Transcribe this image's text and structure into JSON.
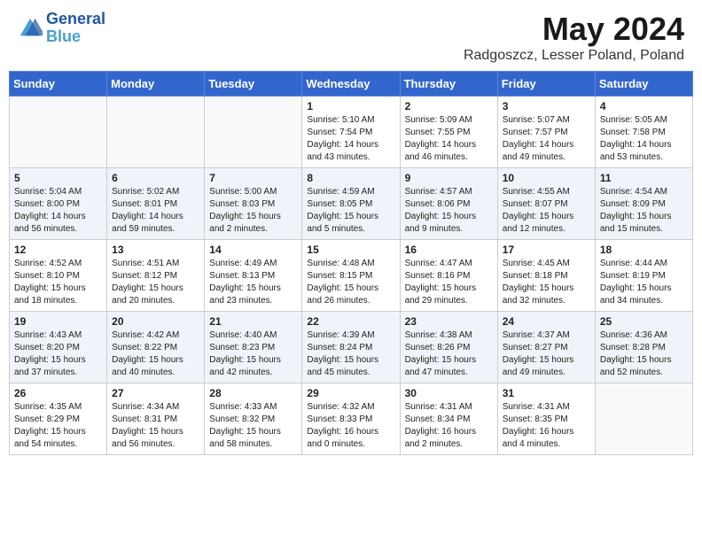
{
  "header": {
    "logo_line1": "General",
    "logo_line2": "Blue",
    "month": "May 2024",
    "location": "Radgoszcz, Lesser Poland, Poland"
  },
  "weekdays": [
    "Sunday",
    "Monday",
    "Tuesday",
    "Wednesday",
    "Thursday",
    "Friday",
    "Saturday"
  ],
  "weeks": [
    [
      {
        "day": "",
        "sunrise": "",
        "sunset": "",
        "daylight": ""
      },
      {
        "day": "",
        "sunrise": "",
        "sunset": "",
        "daylight": ""
      },
      {
        "day": "",
        "sunrise": "",
        "sunset": "",
        "daylight": ""
      },
      {
        "day": "1",
        "sunrise": "Sunrise: 5:10 AM",
        "sunset": "Sunset: 7:54 PM",
        "daylight": "Daylight: 14 hours and 43 minutes."
      },
      {
        "day": "2",
        "sunrise": "Sunrise: 5:09 AM",
        "sunset": "Sunset: 7:55 PM",
        "daylight": "Daylight: 14 hours and 46 minutes."
      },
      {
        "day": "3",
        "sunrise": "Sunrise: 5:07 AM",
        "sunset": "Sunset: 7:57 PM",
        "daylight": "Daylight: 14 hours and 49 minutes."
      },
      {
        "day": "4",
        "sunrise": "Sunrise: 5:05 AM",
        "sunset": "Sunset: 7:58 PM",
        "daylight": "Daylight: 14 hours and 53 minutes."
      }
    ],
    [
      {
        "day": "5",
        "sunrise": "Sunrise: 5:04 AM",
        "sunset": "Sunset: 8:00 PM",
        "daylight": "Daylight: 14 hours and 56 minutes."
      },
      {
        "day": "6",
        "sunrise": "Sunrise: 5:02 AM",
        "sunset": "Sunset: 8:01 PM",
        "daylight": "Daylight: 14 hours and 59 minutes."
      },
      {
        "day": "7",
        "sunrise": "Sunrise: 5:00 AM",
        "sunset": "Sunset: 8:03 PM",
        "daylight": "Daylight: 15 hours and 2 minutes."
      },
      {
        "day": "8",
        "sunrise": "Sunrise: 4:59 AM",
        "sunset": "Sunset: 8:05 PM",
        "daylight": "Daylight: 15 hours and 5 minutes."
      },
      {
        "day": "9",
        "sunrise": "Sunrise: 4:57 AM",
        "sunset": "Sunset: 8:06 PM",
        "daylight": "Daylight: 15 hours and 9 minutes."
      },
      {
        "day": "10",
        "sunrise": "Sunrise: 4:55 AM",
        "sunset": "Sunset: 8:07 PM",
        "daylight": "Daylight: 15 hours and 12 minutes."
      },
      {
        "day": "11",
        "sunrise": "Sunrise: 4:54 AM",
        "sunset": "Sunset: 8:09 PM",
        "daylight": "Daylight: 15 hours and 15 minutes."
      }
    ],
    [
      {
        "day": "12",
        "sunrise": "Sunrise: 4:52 AM",
        "sunset": "Sunset: 8:10 PM",
        "daylight": "Daylight: 15 hours and 18 minutes."
      },
      {
        "day": "13",
        "sunrise": "Sunrise: 4:51 AM",
        "sunset": "Sunset: 8:12 PM",
        "daylight": "Daylight: 15 hours and 20 minutes."
      },
      {
        "day": "14",
        "sunrise": "Sunrise: 4:49 AM",
        "sunset": "Sunset: 8:13 PM",
        "daylight": "Daylight: 15 hours and 23 minutes."
      },
      {
        "day": "15",
        "sunrise": "Sunrise: 4:48 AM",
        "sunset": "Sunset: 8:15 PM",
        "daylight": "Daylight: 15 hours and 26 minutes."
      },
      {
        "day": "16",
        "sunrise": "Sunrise: 4:47 AM",
        "sunset": "Sunset: 8:16 PM",
        "daylight": "Daylight: 15 hours and 29 minutes."
      },
      {
        "day": "17",
        "sunrise": "Sunrise: 4:45 AM",
        "sunset": "Sunset: 8:18 PM",
        "daylight": "Daylight: 15 hours and 32 minutes."
      },
      {
        "day": "18",
        "sunrise": "Sunrise: 4:44 AM",
        "sunset": "Sunset: 8:19 PM",
        "daylight": "Daylight: 15 hours and 34 minutes."
      }
    ],
    [
      {
        "day": "19",
        "sunrise": "Sunrise: 4:43 AM",
        "sunset": "Sunset: 8:20 PM",
        "daylight": "Daylight: 15 hours and 37 minutes."
      },
      {
        "day": "20",
        "sunrise": "Sunrise: 4:42 AM",
        "sunset": "Sunset: 8:22 PM",
        "daylight": "Daylight: 15 hours and 40 minutes."
      },
      {
        "day": "21",
        "sunrise": "Sunrise: 4:40 AM",
        "sunset": "Sunset: 8:23 PM",
        "daylight": "Daylight: 15 hours and 42 minutes."
      },
      {
        "day": "22",
        "sunrise": "Sunrise: 4:39 AM",
        "sunset": "Sunset: 8:24 PM",
        "daylight": "Daylight: 15 hours and 45 minutes."
      },
      {
        "day": "23",
        "sunrise": "Sunrise: 4:38 AM",
        "sunset": "Sunset: 8:26 PM",
        "daylight": "Daylight: 15 hours and 47 minutes."
      },
      {
        "day": "24",
        "sunrise": "Sunrise: 4:37 AM",
        "sunset": "Sunset: 8:27 PM",
        "daylight": "Daylight: 15 hours and 49 minutes."
      },
      {
        "day": "25",
        "sunrise": "Sunrise: 4:36 AM",
        "sunset": "Sunset: 8:28 PM",
        "daylight": "Daylight: 15 hours and 52 minutes."
      }
    ],
    [
      {
        "day": "26",
        "sunrise": "Sunrise: 4:35 AM",
        "sunset": "Sunset: 8:29 PM",
        "daylight": "Daylight: 15 hours and 54 minutes."
      },
      {
        "day": "27",
        "sunrise": "Sunrise: 4:34 AM",
        "sunset": "Sunset: 8:31 PM",
        "daylight": "Daylight: 15 hours and 56 minutes."
      },
      {
        "day": "28",
        "sunrise": "Sunrise: 4:33 AM",
        "sunset": "Sunset: 8:32 PM",
        "daylight": "Daylight: 15 hours and 58 minutes."
      },
      {
        "day": "29",
        "sunrise": "Sunrise: 4:32 AM",
        "sunset": "Sunset: 8:33 PM",
        "daylight": "Daylight: 16 hours and 0 minutes."
      },
      {
        "day": "30",
        "sunrise": "Sunrise: 4:31 AM",
        "sunset": "Sunset: 8:34 PM",
        "daylight": "Daylight: 16 hours and 2 minutes."
      },
      {
        "day": "31",
        "sunrise": "Sunrise: 4:31 AM",
        "sunset": "Sunset: 8:35 PM",
        "daylight": "Daylight: 16 hours and 4 minutes."
      },
      {
        "day": "",
        "sunrise": "",
        "sunset": "",
        "daylight": ""
      }
    ]
  ]
}
